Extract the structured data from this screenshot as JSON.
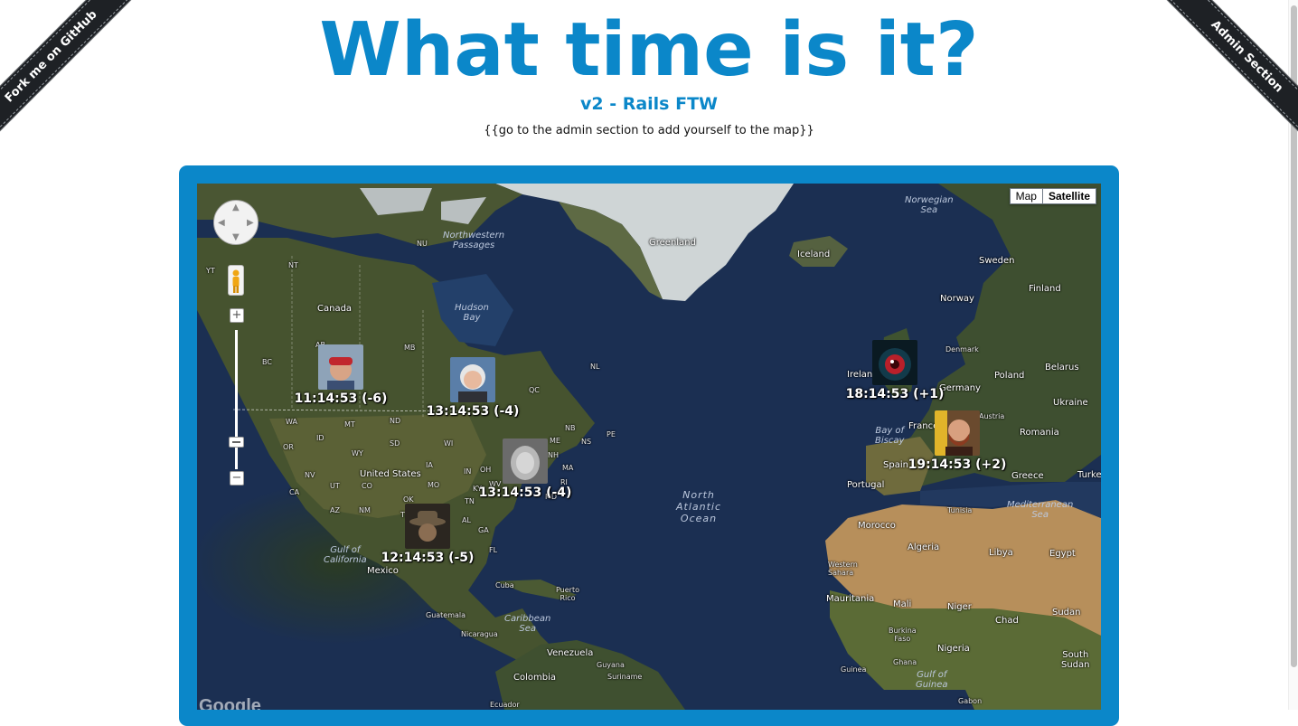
{
  "header": {
    "title": "What time is it?",
    "subtitle": "v2 - Rails FTW",
    "tagline": "{{go to the admin section to add yourself to the map}}"
  },
  "ribbons": {
    "github": "Fork me on GitHub",
    "admin": "Admin Section"
  },
  "map": {
    "type_options": [
      "Map",
      "Satellite"
    ],
    "active_type": "Satellite",
    "attribution_logo": "Google",
    "labels": {
      "greenland": "Greenland",
      "iceland": "Iceland",
      "norwegian_sea": "Norwegian\nSea",
      "sweden": "Sweden",
      "finland": "Finland",
      "norway": "Norway",
      "denmark": "Denmark",
      "ireland": "Ireland",
      "poland": "Poland",
      "belarus": "Belarus",
      "germany": "Germany",
      "ukraine": "Ukraine",
      "france": "France",
      "austria": "Austria",
      "romania": "Romania",
      "bay_of_biscay": "Bay of\nBiscay",
      "spain": "Spain",
      "portugal": "Portugal",
      "greece": "Greece",
      "turkey": "Turke",
      "tunisia": "Tunisia",
      "mediterranean": "Mediterranean\nSea",
      "morocco": "Morocco",
      "algeria": "Algeria",
      "libya": "Libya",
      "egypt": "Egypt",
      "western_sahara": "Western\nSahara",
      "mauritania": "Mauritania",
      "mali": "Mali",
      "niger": "Niger",
      "chad": "Chad",
      "sudan": "Sudan",
      "burkina_faso": "Burkina\nFaso",
      "guinea": "Guinea",
      "nigeria": "Nigeria",
      "south_sudan": "South\nSudan",
      "ghana": "Ghana",
      "gulf_of_guinea": "Gulf of\nGuinea",
      "gabon": "Gabon",
      "north_atlantic": "North\nAtlantic\nOcean",
      "canada": "Canada",
      "hudson_bay": "Hudson\nBay",
      "northwestern_passages": "Northwestern\nPassages",
      "united_states": "United States",
      "mexico": "Mexico",
      "gulf_of_california": "Gulf of\nCalifornia",
      "cuba": "Cuba",
      "puerto_rico": "Puerto\nRico",
      "caribbean": "Caribbean\nSea",
      "guatemala": "Guatemala",
      "nicaragua": "Nicaragua",
      "venezuela": "Venezuela",
      "colombia": "Colombia",
      "guyana": "Guyana",
      "suriname": "Suriname",
      "ecuador": "Ecuador",
      "nu": "NU",
      "nt": "NT",
      "yt": "YT",
      "bc": "BC",
      "ab": "AB",
      "mb": "MB",
      "qc": "QC",
      "nl": "NL",
      "nb": "NB",
      "ns": "NS",
      "pe": "PE",
      "me": "ME",
      "nh": "NH",
      "ma": "MA",
      "ri": "RI",
      "wa": "WA",
      "or": "OR",
      "nd": "ND",
      "sd": "SD",
      "wy": "WY",
      "nv": "NV",
      "ut": "UT",
      "co": "CO",
      "ca": "CA",
      "az": "AZ",
      "nm": "NM",
      "tx": "TX",
      "mo": "MO",
      "ok": "OK",
      "in": "IN",
      "oh": "OH",
      "wv": "WV",
      "ky": "KY",
      "tn": "TN",
      "al": "AL",
      "ga": "GA",
      "fl": "FL",
      "md": "MD",
      "wi": "WI",
      "ia": "IA",
      "mt": "MT",
      "id": "ID"
    },
    "markers": [
      {
        "time": "11:14:53 (-6)",
        "photo": "person-red-cap"
      },
      {
        "time": "13:14:53 (-4)",
        "photo": "person-white-hair"
      },
      {
        "time": "13:14:53 (-4)",
        "photo": "person-bw-blurred"
      },
      {
        "time": "12:14:53 (-5)",
        "photo": "person-hat"
      },
      {
        "time": "18:14:53 (+1)",
        "photo": "red-eye-avatar"
      },
      {
        "time": "19:14:53 (+2)",
        "photo": "person-bald-beard"
      }
    ]
  },
  "colors": {
    "brand": "#0b87c9",
    "ocean": "#1b2f52",
    "ribbon": "#1e2125"
  }
}
